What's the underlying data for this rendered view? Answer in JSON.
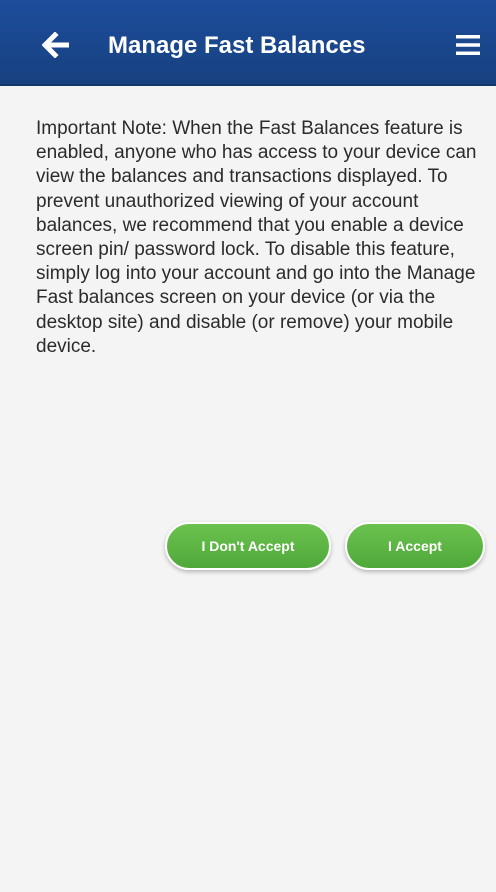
{
  "header": {
    "title": "Manage Fast Balances",
    "back_icon": "arrow-left-icon",
    "menu_icon": "hamburger-menu-icon",
    "background_color": "#1b4a93"
  },
  "main": {
    "note": "Important Note: When the Fast Balances feature is enabled, anyone who has access to your device can view the balances and transactions displayed. To prevent unauthorized viewing of your account balances, we recommend that you enable a device screen pin/ password lock. To disable this feature, simply log into your account and go into the Manage Fast balances screen on your device (or via the desktop site) and disable (or remove) your mobile device."
  },
  "actions": {
    "decline_label": "I Don't Accept",
    "accept_label": "I Accept",
    "button_color": "#5cb543"
  }
}
